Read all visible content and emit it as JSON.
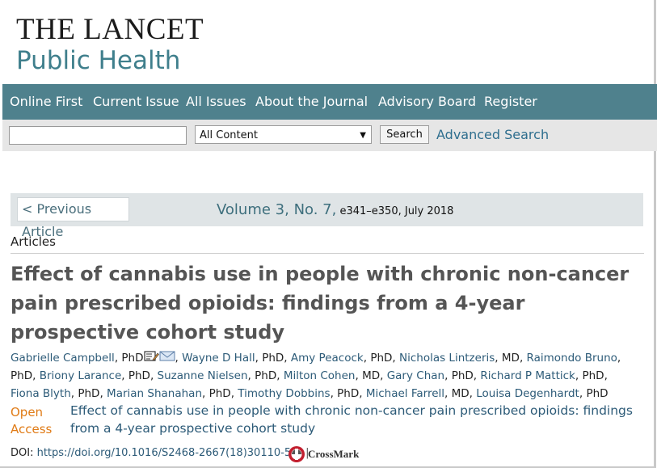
{
  "logo": {
    "line1": "THE LANCET",
    "line2": "Public Health"
  },
  "nav": [
    "Online First",
    "Current Issue",
    "All Issues",
    "About the Journal",
    "Advisory Board",
    "Register"
  ],
  "search": {
    "select_value": "All Content",
    "button": "Search",
    "advanced": "Advanced Search"
  },
  "issue": {
    "prev": "< Previous Article",
    "volume": "Volume 3, No. 7,",
    "pages": " e341–e350, July 2018"
  },
  "article": {
    "section": "Articles",
    "title": "Effect of cannabis use in people with chronic non-cancer pain prescribed opioids: findings from a 4-year prospective cohort study",
    "authors": [
      "Gabrielle Campbell",
      "Wayne D Hall",
      "Amy Peacock",
      "Nicholas Lintzeris",
      "Raimondo Bruno",
      "Briony Larance",
      "Suzanne Nielsen",
      "Milton Cohen",
      "Gary Chan",
      "Richard P Mattick",
      "Fiona Blyth",
      "Marian Shanahan",
      "Timothy Dobbins",
      "Michael Farrell",
      "Louisa Degenhardt"
    ],
    "degrees": [
      "PhD",
      "PhD",
      "PhD",
      "MD",
      "PhD",
      "PhD",
      "PhD",
      "MD",
      "PhD",
      "PhD",
      "PhD",
      "PhD",
      "PhD",
      "MD",
      "PhD"
    ],
    "open_access": "Open Access",
    "oa_title": "Effect of cannabis use in people with chronic non-cancer pain prescribed opioids: findings from a 4-year prospective cohort study",
    "doi_label": "DOI: ",
    "doi": "https://doi.org/10.1016/S2468-2667(18)30110-5",
    "separator": "|",
    "crossmark": "CrossMark"
  },
  "icons": [
    "edit-note-icon",
    "email-icon",
    "crossmark-icon",
    "dropdown-arrow-icon"
  ],
  "colors": {
    "nav_bg": "#4f818d",
    "link": "#2d5b78",
    "open_access": "#e07b16"
  }
}
